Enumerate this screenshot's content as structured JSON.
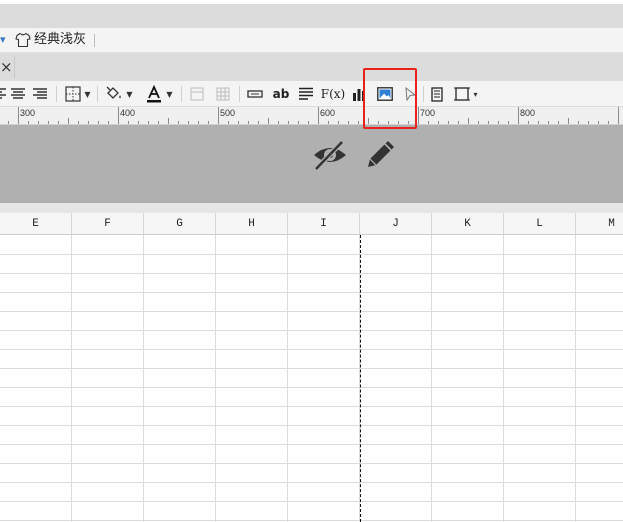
{
  "theme": {
    "label": "经典浅灰",
    "icon": "shirt-icon"
  },
  "tab": {
    "close_label": "×"
  },
  "toolbar": {
    "text_wrap_label": "ab",
    "formula_label": "F(x)",
    "highlighted_tool": "insert-image"
  },
  "ruler": {
    "labels": [
      "300",
      "400",
      "500",
      "600",
      "700",
      "800"
    ]
  },
  "preview": {
    "icons": [
      "eye-slash-icon",
      "pencil-icon"
    ]
  },
  "grid": {
    "columns": [
      "E",
      "F",
      "G",
      "H",
      "I",
      "J",
      "K",
      "L",
      "M"
    ]
  },
  "colors": {
    "highlight": "#e8211b",
    "preview_band": "#b0b0b0",
    "image_icon_blue": "#2f7fd8"
  }
}
